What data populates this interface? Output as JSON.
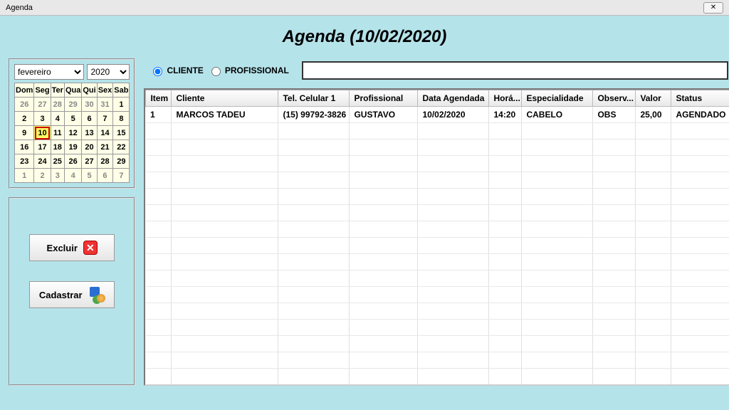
{
  "window": {
    "title": "Agenda",
    "close_glyph": "✕"
  },
  "page": {
    "title": "Agenda (10/02/2020)"
  },
  "calendar": {
    "month_label": "fevereiro",
    "year_label": "2020",
    "dow": [
      "Dom",
      "Seg",
      "Ter",
      "Qua",
      "Qui",
      "Sex",
      "Sab"
    ],
    "weeks": [
      [
        {
          "d": "26",
          "other": true
        },
        {
          "d": "27",
          "other": true
        },
        {
          "d": "28",
          "other": true
        },
        {
          "d": "29",
          "other": true
        },
        {
          "d": "30",
          "other": true
        },
        {
          "d": "31",
          "other": true
        },
        {
          "d": "1"
        }
      ],
      [
        {
          "d": "2"
        },
        {
          "d": "3"
        },
        {
          "d": "4"
        },
        {
          "d": "5"
        },
        {
          "d": "6"
        },
        {
          "d": "7"
        },
        {
          "d": "8"
        }
      ],
      [
        {
          "d": "9"
        },
        {
          "d": "10",
          "selected": true
        },
        {
          "d": "11"
        },
        {
          "d": "12"
        },
        {
          "d": "13"
        },
        {
          "d": "14"
        },
        {
          "d": "15"
        }
      ],
      [
        {
          "d": "16"
        },
        {
          "d": "17"
        },
        {
          "d": "18"
        },
        {
          "d": "19"
        },
        {
          "d": "20"
        },
        {
          "d": "21"
        },
        {
          "d": "22"
        }
      ],
      [
        {
          "d": "23"
        },
        {
          "d": "24"
        },
        {
          "d": "25"
        },
        {
          "d": "26"
        },
        {
          "d": "27"
        },
        {
          "d": "28"
        },
        {
          "d": "29"
        }
      ],
      [
        {
          "d": "1",
          "other": true
        },
        {
          "d": "2",
          "other": true
        },
        {
          "d": "3",
          "other": true
        },
        {
          "d": "4",
          "other": true
        },
        {
          "d": "5",
          "other": true
        },
        {
          "d": "6",
          "other": true
        },
        {
          "d": "7",
          "other": true
        }
      ]
    ]
  },
  "buttons": {
    "delete_label": "Excluir",
    "create_label": "Cadastrar"
  },
  "filter": {
    "client_label": "CLIENTE",
    "professional_label": "PROFISSIONAL",
    "selected": "CLIENTE",
    "search_value": ""
  },
  "grid": {
    "columns": [
      "Item",
      "Cliente",
      "Tel. Celular 1",
      "Profissional",
      "Data Agendada",
      "Horá...",
      "Especialidade",
      "Observ...",
      "Valor",
      "Status"
    ],
    "col_widths": [
      "36px",
      "150px",
      "100px",
      "96px",
      "100px",
      "46px",
      "100px",
      "60px",
      "50px",
      "86px"
    ],
    "rows": [
      {
        "item": "1",
        "cliente": "MARCOS TADEU",
        "tel": "(15) 99792-3826",
        "prof": "GUSTAVO",
        "data": "10/02/2020",
        "hora": "14:20",
        "esp": "CABELO",
        "obs": "OBS",
        "valor": "25,00",
        "status": "AGENDADO"
      }
    ],
    "empty_rows": 16
  }
}
